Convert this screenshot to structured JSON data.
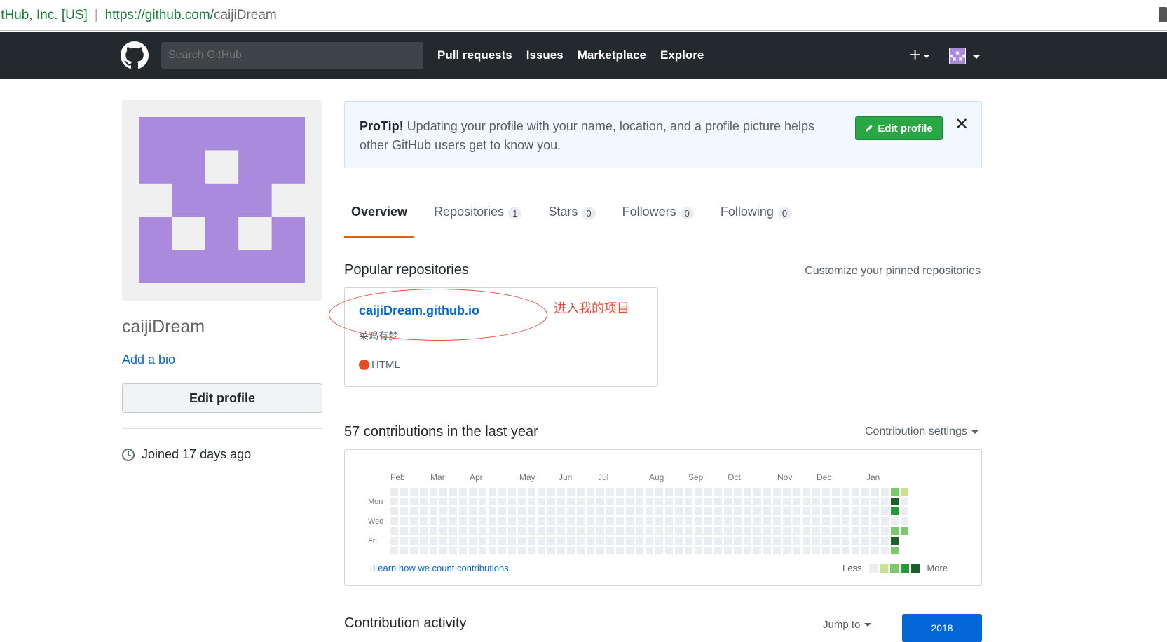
{
  "browser": {
    "org": "itHub, Inc. [US]",
    "url_host": "https://github.com/",
    "url_path": "caijiDream"
  },
  "header": {
    "search_placeholder": "Search GitHub",
    "nav": [
      "Pull requests",
      "Issues",
      "Marketplace",
      "Explore"
    ],
    "plus_label": "+"
  },
  "profile": {
    "username": "caijiDream",
    "add_bio": "Add a bio",
    "edit_profile": "Edit profile",
    "joined": "Joined 17 days ago",
    "avatar_color": "#a98add"
  },
  "protip": {
    "label": "ProTip!",
    "text": " Updating your profile with your name, location, and a profile picture helps other GitHub users get to know you.",
    "button": "Edit profile",
    "close": "✕"
  },
  "tabs": [
    {
      "label": "Overview",
      "count": null,
      "active": true
    },
    {
      "label": "Repositories",
      "count": "1",
      "active": false
    },
    {
      "label": "Stars",
      "count": "0",
      "active": false
    },
    {
      "label": "Followers",
      "count": "0",
      "active": false
    },
    {
      "label": "Following",
      "count": "0",
      "active": false
    }
  ],
  "popular": {
    "title": "Popular repositories",
    "customize": "Customize your pinned repositories",
    "repo": {
      "name": "caijiDream.github.io",
      "description": "菜鸡有梦",
      "language": "HTML",
      "language_color": "#e34c26"
    },
    "annotation": "进入我的项目"
  },
  "contributions": {
    "title": "57 contributions in the last year",
    "settings": "Contribution settings",
    "months": [
      "Feb",
      "Mar",
      "Apr",
      "May",
      "Jun",
      "Jul",
      "Aug",
      "Sep",
      "Oct",
      "Nov",
      "Dec",
      "Jan"
    ],
    "days": [
      "Mon",
      "Wed",
      "Fri"
    ],
    "learn": "Learn how we count contributions.",
    "less": "Less",
    "more": "More",
    "colors": [
      "#ebedf0",
      "#c6e48b",
      "#7bc96f",
      "#239a3b",
      "#196127"
    ],
    "active_cells": [
      {
        "week": 51,
        "day": 0,
        "level": 2
      },
      {
        "week": 51,
        "day": 1,
        "level": 4
      },
      {
        "week": 51,
        "day": 2,
        "level": 3
      },
      {
        "week": 51,
        "day": 4,
        "level": 2
      },
      {
        "week": 51,
        "day": 5,
        "level": 4
      },
      {
        "week": 51,
        "day": 6,
        "level": 2
      },
      {
        "week": 52,
        "day": 0,
        "level": 1
      },
      {
        "week": 52,
        "day": 4,
        "level": 2
      }
    ]
  },
  "activity": {
    "title": "Contribution activity",
    "jump_to": "Jump to",
    "year": "2018"
  }
}
